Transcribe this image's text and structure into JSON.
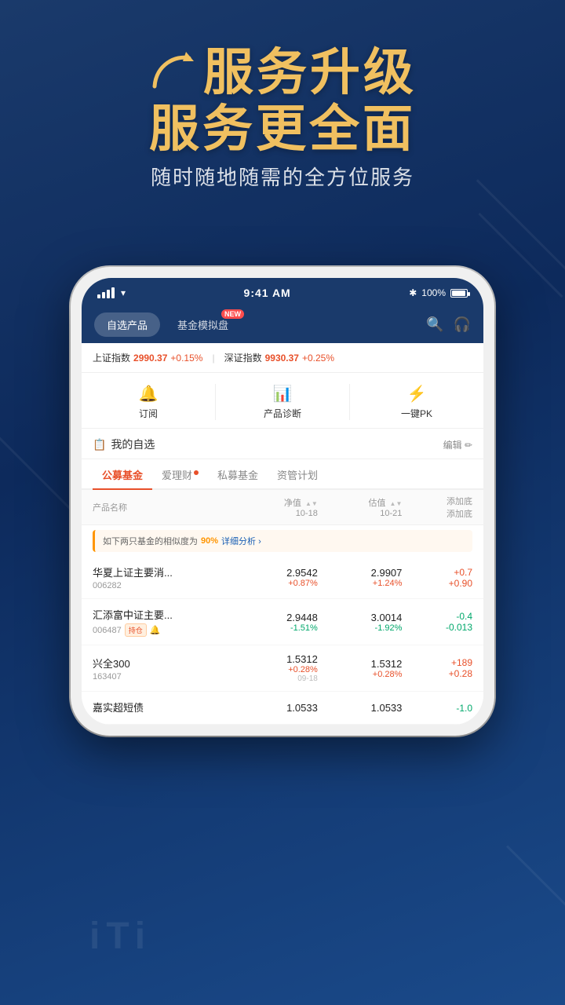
{
  "background": {
    "gradient_start": "#1a3a6b",
    "gradient_end": "#0d2a5c"
  },
  "headline": {
    "line1": "服务升级",
    "line2": "服务更全面",
    "subtitle": "随时随地随需的全方位服务"
  },
  "status_bar": {
    "time": "9:41 AM",
    "battery": "100%"
  },
  "nav": {
    "tab1": "自选产品",
    "tab2": "基金模拟盘",
    "new_badge": "NEW"
  },
  "ticker": {
    "label1": "上证指数",
    "value1": "2990.37",
    "change1": "+0.15%",
    "label2": "深证指数",
    "value2": "9930.37",
    "change2": "+0.25%"
  },
  "quick_actions": [
    {
      "icon": "🔔",
      "label": "订阅"
    },
    {
      "icon": "📊",
      "label": "产品诊断"
    },
    {
      "icon": "⚡",
      "label": "一键PK"
    }
  ],
  "section": {
    "title": "我的自选",
    "edit": "编辑"
  },
  "cat_tabs": [
    {
      "label": "公募基金",
      "active": true,
      "dot": false
    },
    {
      "label": "爱理财",
      "active": false,
      "dot": true
    },
    {
      "label": "私募基金",
      "active": false,
      "dot": false
    },
    {
      "label": "资管计划",
      "active": false,
      "dot": false
    }
  ],
  "table_header": {
    "col_name": "产品名称",
    "col_nav": "净值",
    "col_nav_date": "10-18",
    "col_est": "估值",
    "col_est_date": "10-21",
    "col_add": "添加底",
    "col_add2": "添加底"
  },
  "similarity_alert": {
    "prefix": "如下两只基金的相似度为",
    "pct": "90%",
    "link": "详细分析 ›"
  },
  "funds": [
    {
      "name": "华夏上证主要消...",
      "code": "006282",
      "nav": "2.9542",
      "nav_chg": "+0.87%",
      "est": "2.9907",
      "est_chg": "+1.24%",
      "change": "+0.7",
      "change2": "+0.90",
      "pos": true,
      "tag": "",
      "bell": false
    },
    {
      "name": "汇添富中证主要...",
      "code": "006487",
      "nav": "2.9448",
      "nav_chg": "-1.51%",
      "est": "3.0014",
      "est_chg": "-1.92%",
      "change": "-0.4",
      "change2": "-0.013",
      "pos": false,
      "tag": "持仓",
      "bell": true
    },
    {
      "name": "兴全300",
      "code": "163407",
      "nav": "1.5312",
      "nav_chg": "+0.28%",
      "nav_date": "09-18",
      "est": "1.5312",
      "est_chg": "+0.28%",
      "change": "+189",
      "change2": "+0.28",
      "pos": true,
      "tag": "",
      "bell": false
    },
    {
      "name": "嘉实超短债",
      "code": "",
      "nav": "1.0533",
      "nav_chg": "",
      "est": "1.0533",
      "est_chg": "",
      "change": "-1.0",
      "change2": "",
      "pos": false,
      "tag": "",
      "bell": false
    }
  ],
  "iti_text": "iTi"
}
